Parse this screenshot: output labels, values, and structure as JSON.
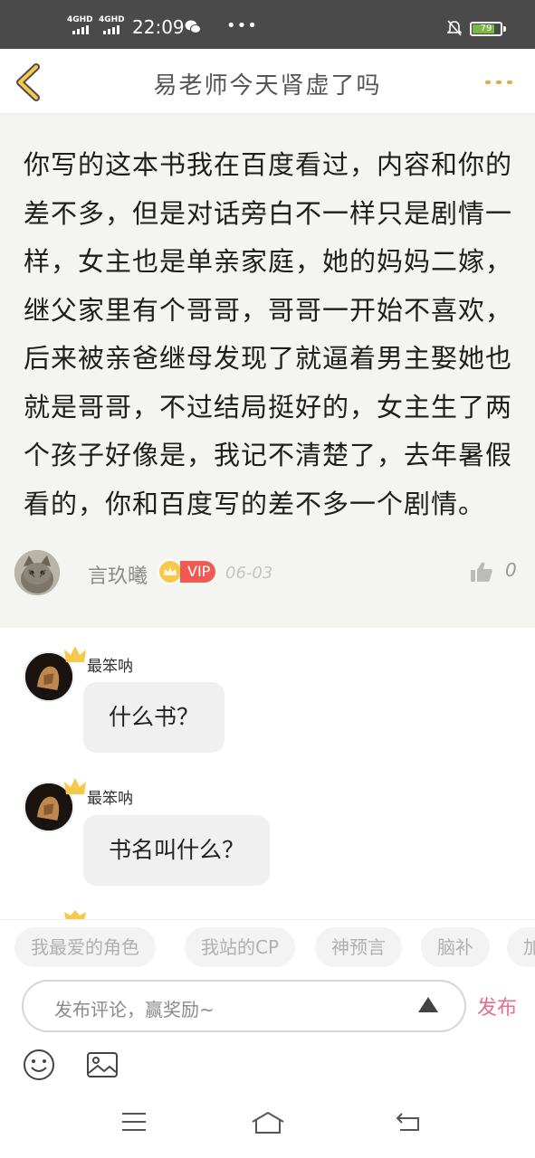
{
  "status_bar": {
    "signal_1": "4GHD",
    "signal_2": "4GHD",
    "time": "22:09",
    "more": "•••",
    "battery": "79",
    "battery_level": 0.79
  },
  "header": {
    "title": "易老师今天肾虚了吗"
  },
  "main_comment": {
    "text": "你写的这本书我在百度看过，内容和你的差不多，但是对话旁白不一样只是剧情一样，女主也是单亲家庭，她的妈妈二嫁，继父家里有个哥哥，哥哥一开始不喜欢，后来被亲爸继母发现了就逼着男主娶她也就是哥哥，不过结局挺好的，女主生了两个孩子好像是，我记不清楚了，去年暑假看的，你和百度写的差不多一个剧情。",
    "author": "言玖曦",
    "vip": "VIP",
    "date": "06-03",
    "likes": "0"
  },
  "replies": [
    {
      "name": "最笨呐",
      "text": "什么书？"
    },
    {
      "name": "最笨呐",
      "text": "书名叫什么？"
    }
  ],
  "tags": [
    "我最爱的角色",
    "我站的CP",
    "神预言",
    "脑补",
    "加"
  ],
  "input": {
    "placeholder": "发布评论，赢奖励~",
    "publish": "发布"
  },
  "icons": {
    "back": "chevron-left-icon",
    "more": "more-dots-icon",
    "like": "thumbs-up-icon",
    "emoji": "smiley-icon",
    "image": "image-icon",
    "expand": "triangle-up-icon",
    "nav_menu": "menu-icon",
    "nav_home": "home-icon",
    "nav_back": "back-arrow-icon"
  },
  "colors": {
    "accent": "#f3a14c",
    "vip": "#f05a52",
    "publish": "#e86c8b",
    "comment_bg": "#f4f4f0"
  }
}
